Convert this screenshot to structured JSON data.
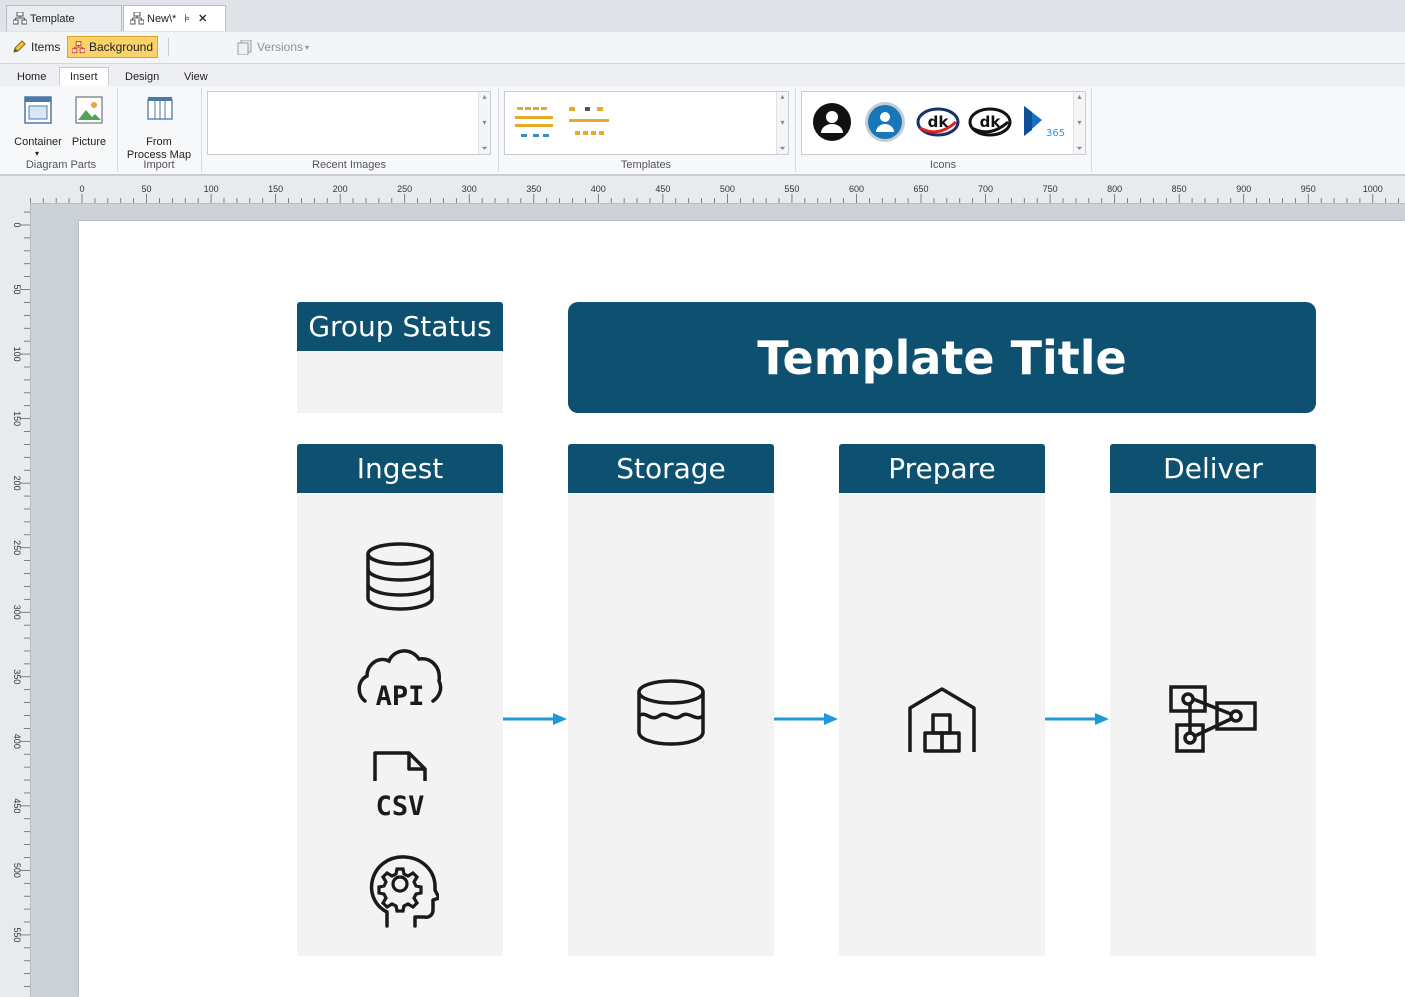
{
  "doc_tabs": [
    {
      "label": "Template"
    },
    {
      "label": "New\\*"
    }
  ],
  "quickbar": {
    "items_label": "Items",
    "background_label": "Background",
    "versions_label": "Versions"
  },
  "ribbon_tabs": [
    "Home",
    "Insert",
    "Design",
    "View"
  ],
  "ribbon": {
    "container_label": "Container",
    "picture_label": "Picture",
    "from_process_map_line1": "From",
    "from_process_map_line2": "Process Map",
    "groups": {
      "diagram_parts": "Diagram Parts",
      "import": "Import",
      "recent_images": "Recent Images",
      "templates": "Templates",
      "icons": "Icons"
    },
    "icons_gallery": [
      "person-black-icon",
      "person-blue-icon",
      "dk-red-logo",
      "dk-black-logo",
      "dynamics-365-logo"
    ],
    "dynamics_text": "365",
    "dk_text": "dk"
  },
  "hruler": [
    "0",
    "50",
    "100",
    "150",
    "200",
    "250",
    "300",
    "350",
    "400",
    "450",
    "500",
    "550",
    "600",
    "650",
    "700",
    "750",
    "800",
    "850",
    "900",
    "950",
    "1000"
  ],
  "vruler": [
    "0",
    "50",
    "100",
    "150",
    "200",
    "250",
    "300",
    "350",
    "400",
    "450",
    "500",
    "550"
  ],
  "diagram": {
    "group_status": "Group Status",
    "title": "Template Title",
    "lanes": [
      {
        "name": "Ingest",
        "icons": [
          "database-icon",
          "api-cloud-icon",
          "csv-file-icon",
          "head-gear-icon"
        ]
      },
      {
        "name": "Storage",
        "icons": [
          "data-lake-icon"
        ]
      },
      {
        "name": "Prepare",
        "icons": [
          "warehouse-icon"
        ]
      },
      {
        "name": "Deliver",
        "icons": [
          "network-diagram-icon"
        ]
      }
    ],
    "api_text": "API",
    "csv_text": "CSV"
  },
  "colors": {
    "lane_header": "#0e506f",
    "arrow": "#1e9ad6",
    "highlight": "#fbd26a"
  }
}
